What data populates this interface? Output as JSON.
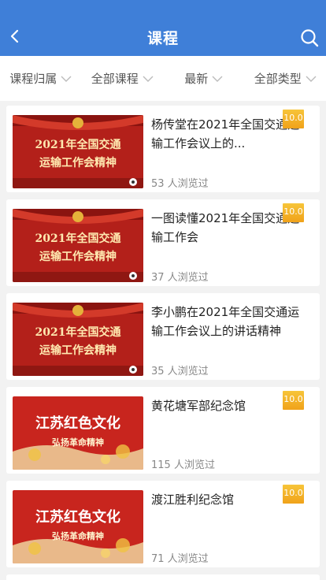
{
  "header": {
    "title": "课程"
  },
  "filters": [
    {
      "label": "课程归属"
    },
    {
      "label": "全部课程"
    },
    {
      "label": "最新"
    },
    {
      "label": "全部类型"
    }
  ],
  "courses": [
    {
      "title": "杨传堂在2021年全国交通运输工作会议上的...",
      "views": "53 人浏览过",
      "score": "10.0",
      "thumb_line1": "2021年全国交通",
      "thumb_line2": "运输工作会精神"
    },
    {
      "title": "一图读懂2021年全国交通运输工作会",
      "views": "37 人浏览过",
      "score": "10.0",
      "thumb_line1": "2021年全国交通",
      "thumb_line2": "运输工作会精神"
    },
    {
      "title": "李小鹏在2021年全国交通运输工作会议上的讲话精神",
      "views": "35 人浏览过",
      "score": "",
      "thumb_line1": "2021年全国交通",
      "thumb_line2": "运输工作会精神"
    },
    {
      "title": "黄花塘军部纪念馆",
      "views": "115 人浏览过",
      "score": "10.0",
      "thumb_line1": "江苏红色文化",
      "thumb_line2": "弘扬革命精神"
    },
    {
      "title": "渡江胜利纪念馆",
      "views": "71 人浏览过",
      "score": "10.0",
      "thumb_line1": "江苏红色文化",
      "thumb_line2": "弘扬革命精神"
    }
  ],
  "colors": {
    "header": "#3f7fd8",
    "score": "#f0a21a",
    "thumb_red": "#c8251e"
  }
}
